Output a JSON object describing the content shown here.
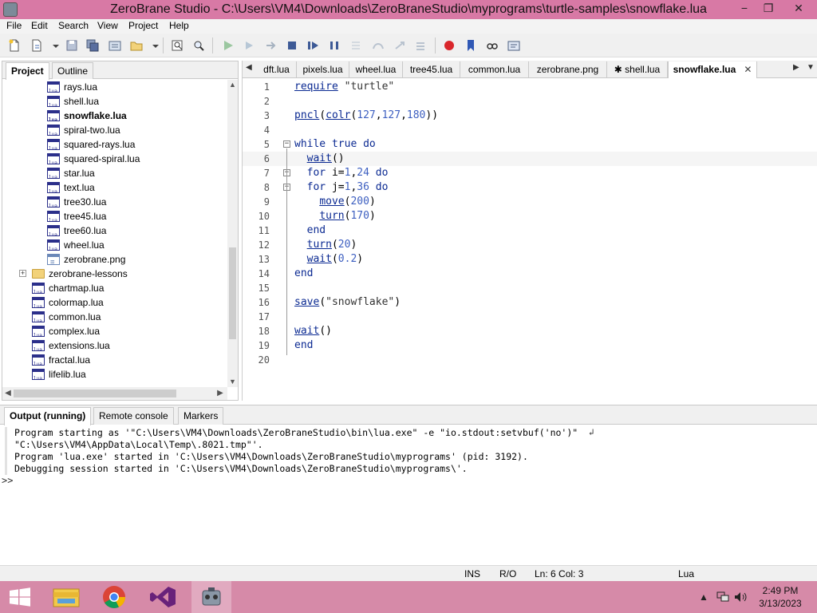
{
  "window": {
    "title": "ZeroBrane Studio - C:\\Users\\VM4\\Downloads\\ZeroBraneStudio\\myprograms\\turtle-samples\\snowflake.lua",
    "min_glyph": "−",
    "max_glyph": "❐",
    "close_glyph": "✕"
  },
  "menu": [
    "File",
    "Edit",
    "Search",
    "View",
    "Project",
    "Help"
  ],
  "left_panel": {
    "tabs": [
      "Project",
      "Outline"
    ],
    "active_tab": "Project",
    "tree": [
      {
        "label": "rays.lua",
        "type": "lua",
        "level": 1,
        "bold": false
      },
      {
        "label": "shell.lua",
        "type": "lua",
        "level": 1,
        "bold": false
      },
      {
        "label": "snowflake.lua",
        "type": "lua",
        "level": 1,
        "bold": true
      },
      {
        "label": "spiral-two.lua",
        "type": "lua",
        "level": 1,
        "bold": false
      },
      {
        "label": "squared-rays.lua",
        "type": "lua",
        "level": 1,
        "bold": false
      },
      {
        "label": "squared-spiral.lua",
        "type": "lua",
        "level": 1,
        "bold": false
      },
      {
        "label": "star.lua",
        "type": "lua",
        "level": 1,
        "bold": false
      },
      {
        "label": "text.lua",
        "type": "lua",
        "level": 1,
        "bold": false
      },
      {
        "label": "tree30.lua",
        "type": "lua",
        "level": 1,
        "bold": false
      },
      {
        "label": "tree45.lua",
        "type": "lua",
        "level": 1,
        "bold": false
      },
      {
        "label": "tree60.lua",
        "type": "lua",
        "level": 1,
        "bold": false
      },
      {
        "label": "wheel.lua",
        "type": "lua",
        "level": 1,
        "bold": false
      },
      {
        "label": "zerobrane.png",
        "type": "img",
        "level": 1,
        "bold": false
      },
      {
        "label": "zerobrane-lessons",
        "type": "folder",
        "level": 0,
        "bold": false
      },
      {
        "label": "chartmap.lua",
        "type": "lua",
        "level": 0,
        "bold": false
      },
      {
        "label": "colormap.lua",
        "type": "lua",
        "level": 0,
        "bold": false
      },
      {
        "label": "common.lua",
        "type": "lua",
        "level": 0,
        "bold": false
      },
      {
        "label": "complex.lua",
        "type": "lua",
        "level": 0,
        "bold": false
      },
      {
        "label": "extensions.lua",
        "type": "lua",
        "level": 0,
        "bold": false
      },
      {
        "label": "fractal.lua",
        "type": "lua",
        "level": 0,
        "bold": false
      },
      {
        "label": "lifelib.lua",
        "type": "lua",
        "level": 0,
        "bold": false
      }
    ]
  },
  "editor": {
    "tabs": [
      "dft.lua",
      "pixels.lua",
      "wheel.lua",
      "tree45.lua",
      "common.lua",
      "zerobrane.png",
      "✱ shell.lua",
      "snowflake.lua"
    ],
    "active_tab": "snowflake.lua",
    "close_glyph": "✕",
    "current_line": 6,
    "lines": [
      "require \"turtle\"",
      "",
      "pncl(colr(127,127,180))",
      "",
      "while true do",
      "  wait()",
      "  for i=1,24 do",
      "  for j=1,36 do",
      "    move(200)",
      "    turn(170)",
      "  end",
      "  turn(20)",
      "  wait(0.2)",
      "end",
      "",
      "save(\"snowflake\")",
      "",
      "wait()",
      "end",
      ""
    ]
  },
  "bottom_panel": {
    "tabs": [
      "Output (running)",
      "Remote console",
      "Markers"
    ],
    "active_tab": "Output (running)",
    "output": [
      "Program starting as '\"C:\\Users\\VM4\\Downloads\\ZeroBraneStudio\\bin\\lua.exe\" -e \"io.stdout:setvbuf('no')\"",
      "\"C:\\Users\\VM4\\AppData\\Local\\Temp\\.8021.tmp\"'.",
      "Program 'lua.exe' started in 'C:\\Users\\VM4\\Downloads\\ZeroBraneStudio\\myprograms' (pid: 3192).",
      "Debugging session started in 'C:\\Users\\VM4\\Downloads\\ZeroBraneStudio\\myprograms\\'."
    ],
    "wrap_glyph": "↲",
    "prompt": ">>"
  },
  "status": {
    "mode": "INS",
    "rw": "R/O",
    "position": "Ln: 6 Col: 3",
    "language": "Lua"
  },
  "taskbar": {
    "time": "2:49 PM",
    "date": "3/13/2023"
  },
  "colors": {
    "titlebar": "#d879a5",
    "taskbar": "#d68aa8",
    "keyword": "#0b2a92",
    "number": "#3d5fc0",
    "breakpoint": "#d9262b"
  }
}
